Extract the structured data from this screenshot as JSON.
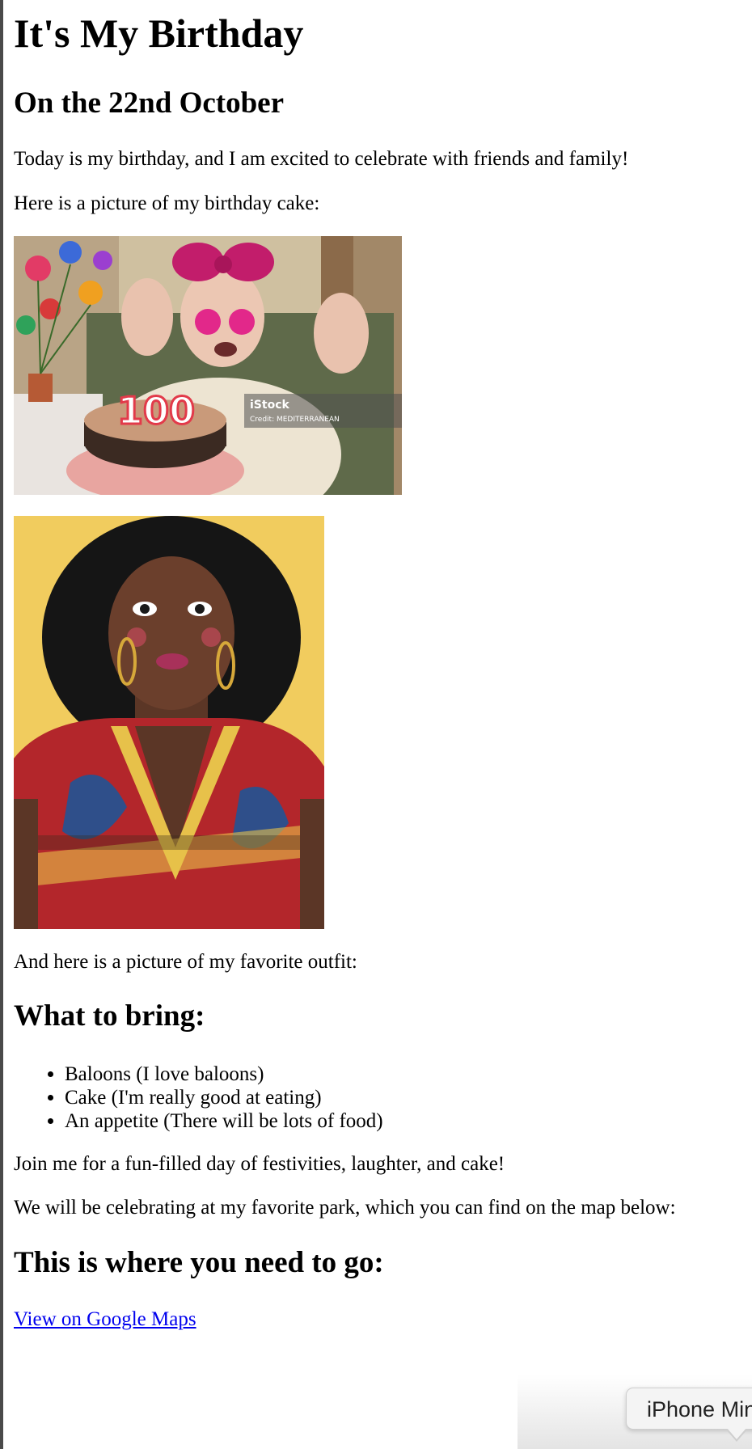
{
  "page": {
    "title": "It's My Birthday",
    "date_heading": "On the 22nd October",
    "intro": "Today is my birthday, and I am excited to celebrate with friends and family!",
    "cake_caption": "Here is a picture of my birthday cake:",
    "cake_image": {
      "candle_number": "100",
      "watermark_brand": "iStock",
      "watermark_credit": "Credit: MEDITERRANEAN"
    },
    "outfit_caption": "And here is a picture of my favorite outfit:",
    "bring_heading": "What to bring:",
    "bring_items": [
      "Baloons (I love baloons)",
      "Cake (I'm really good at eating)",
      "An appetite (There will be lots of food)"
    ],
    "join_text": "Join me for a fun-filled day of festivities, laughter, and cake!",
    "location_text": "We will be celebrating at my favorite park, which you can find on the map below:",
    "directions_heading": "This is where you need to go:",
    "map_link": "View on Google Maps"
  },
  "device_menu": {
    "label": "iPhone Mini"
  },
  "colors": {
    "link": "#0000ee",
    "text": "#000000",
    "background": "#ffffff"
  }
}
